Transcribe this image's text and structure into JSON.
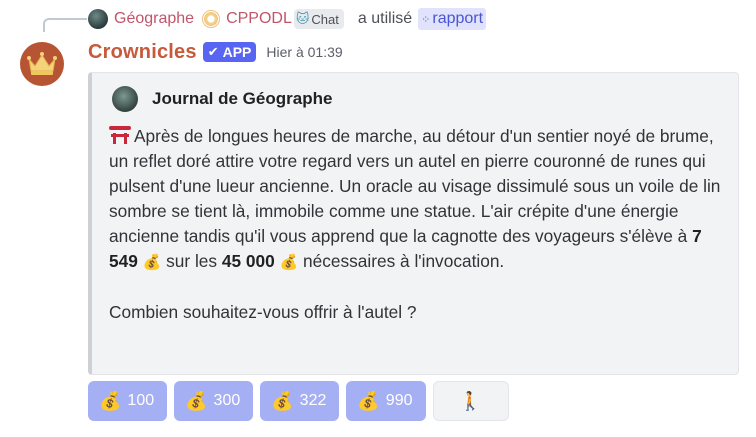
{
  "reply": {
    "user": "Géographe",
    "second_user": "CPPODL",
    "chat_tag": "Chat",
    "used_text": "a utilisé",
    "command": "rapport"
  },
  "message": {
    "bot_name": "Crownicles",
    "app_badge": "APP",
    "timestamp": "Hier à 01:39"
  },
  "embed": {
    "author": "Journal de Géographe",
    "text_before": "Après de longues heures de marche, au détour d'un sentier noyé de brume, un reflet doré attire votre regard vers un autel en pierre couronné de runes qui pulsent d'une lueur ancienne. Un oracle au visage dissimulé sous un voile de lin sombre se tient là, immobile comme une statue. L'air crépite d'une énergie ancienne tandis qu'il vous apprend que la cagnotte des voyageurs s'élève à",
    "pot_current": "7 549",
    "text_middle": "sur les",
    "pot_goal": "45 000",
    "text_after": "nécessaires à l'invocation.",
    "question": "Combien souhaitez-vous offrir à l'autel ?"
  },
  "buttons": [
    {
      "label": "100",
      "icon": "money-bag-icon"
    },
    {
      "label": "300",
      "icon": "money-bag-icon"
    },
    {
      "label": "322",
      "icon": "money-bag-icon"
    },
    {
      "label": "990",
      "icon": "money-bag-icon"
    },
    {
      "label": "",
      "icon": "walking-person-icon"
    }
  ],
  "colors": {
    "bot_name": "#c75a3a",
    "reply_user": "#c2556a",
    "app_badge": "#5865f2",
    "button_bg": "#a5aff3",
    "command_bg": "#e0e3fb"
  }
}
